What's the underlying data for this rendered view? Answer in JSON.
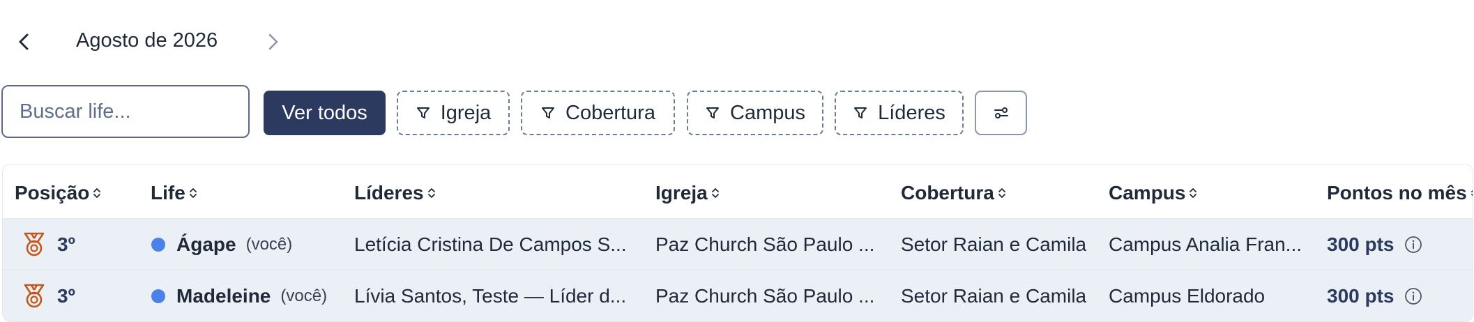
{
  "month_nav": {
    "label": "Agosto de 2026",
    "prev_icon": "chevron-left-icon",
    "next_icon": "chevron-right-icon"
  },
  "filters": {
    "search_placeholder": "Buscar life...",
    "see_all_label": "Ver todos",
    "chips": {
      "igreja": "Igreja",
      "cobertura": "Cobertura",
      "campus": "Campus",
      "lideres": "Líderes"
    },
    "filter_icon": "filter-icon",
    "settings_icon": "sliders-icon"
  },
  "table": {
    "headers": {
      "posicao": "Posição",
      "life": "Life",
      "lideres": "Líderes",
      "igreja": "Igreja",
      "cobertura": "Cobertura",
      "campus": "Campus",
      "pontos": "Pontos no mês"
    },
    "rows": [
      {
        "position": "3º",
        "life": "Ágape",
        "you_tag": "(você)",
        "leaders": "Letícia Cristina De Campos S...",
        "church": "Paz Church São Paulo ...",
        "coverage": "Setor Raian e Camila",
        "campus": "Campus Analia Fran...",
        "points": "300 pts"
      },
      {
        "position": "3º",
        "life": "Madeleine",
        "you_tag": "(você)",
        "leaders": "Lívia Santos, Teste — Líder d...",
        "church": "Paz Church São Paulo ...",
        "coverage": "Setor Raian e Camila",
        "campus": "Campus Eldorado",
        "points": "300 pts"
      }
    ]
  },
  "colors": {
    "primary": "#2b3a5e",
    "row_bg": "#ebf0f7",
    "status_dot": "#4b82e8",
    "medal": "#c2571a"
  }
}
